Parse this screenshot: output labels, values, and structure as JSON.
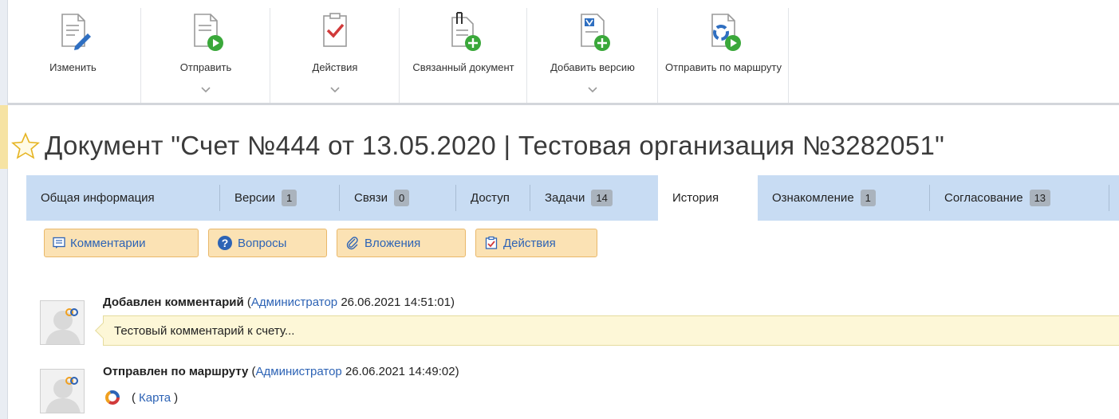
{
  "toolbar": {
    "buttons": [
      {
        "label": "Изменить",
        "icon": "edit-document-icon"
      },
      {
        "label": "Отправить",
        "icon": "send-document-icon"
      },
      {
        "label": "Действия",
        "icon": "actions-checklist-icon"
      },
      {
        "label": "Связанный документ",
        "icon": "linked-document-icon"
      },
      {
        "label": "Добавить версию",
        "icon": "add-version-icon"
      },
      {
        "label": "Отправить по маршруту",
        "icon": "send-by-route-icon"
      }
    ]
  },
  "document": {
    "title": "Документ \"Счет №444 от 13.05.2020 | Тестовая организация №3282051\""
  },
  "tabs": [
    {
      "label": "Общая информация",
      "badge": null,
      "active": false
    },
    {
      "label": "Версии",
      "badge": "1",
      "active": false
    },
    {
      "label": "Связи",
      "badge": "0",
      "active": false
    },
    {
      "label": "Доступ",
      "badge": null,
      "active": false
    },
    {
      "label": "Задачи",
      "badge": "14",
      "active": false
    },
    {
      "label": "История",
      "badge": null,
      "active": true
    },
    {
      "label": "Ознакомление",
      "badge": "1",
      "active": false
    },
    {
      "label": "Согласование",
      "badge": "13",
      "active": false
    }
  ],
  "filters": [
    {
      "label": "Комментарии",
      "icon": "comment-icon"
    },
    {
      "label": "Вопросы",
      "icon": "question-icon"
    },
    {
      "label": "Вложения",
      "icon": "paperclip-icon"
    },
    {
      "label": "Действия",
      "icon": "actions-icon"
    }
  ],
  "history": [
    {
      "action": "Добавлен комментарий",
      "open_paren": "(",
      "user": "Администратор",
      "datetime": "26.06.2021 14:51:01)",
      "comment": "Тестовый комментарий к счету..."
    },
    {
      "action": "Отправлен по маршруту",
      "open_paren": "(",
      "user": "Администратор",
      "datetime": "26.06.2021 14:49:02)",
      "map_open": "(",
      "map_link": "Карта",
      "map_close": ")"
    }
  ],
  "colors": {
    "accent_link": "#2d63b5",
    "tab_bar": "#c8dcf3",
    "filter_button": "#fbe2b4",
    "comment_bg": "#fdf7d7"
  }
}
